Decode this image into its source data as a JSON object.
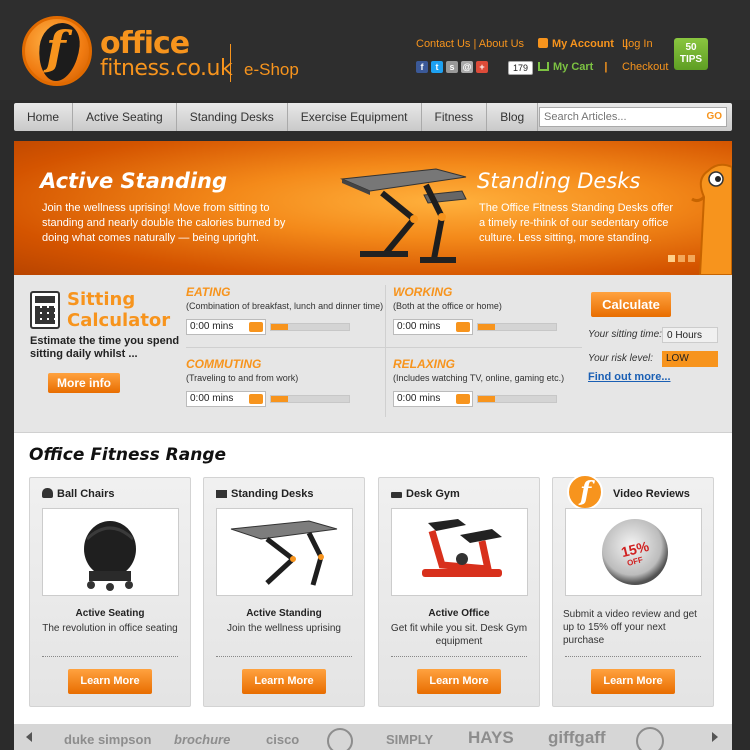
{
  "header": {
    "brand_line1": "office",
    "brand_line2": "fitness.co.uk",
    "eshop": "e-Shop",
    "contact": "Contact Us",
    "about": "About Us",
    "separator": "|",
    "my_account": "My Account",
    "log_in": "Log In",
    "cart_count": "179",
    "my_cart": "My Cart",
    "checkout": "Checkout",
    "tips_number": "50",
    "tips_label": "TIPS"
  },
  "nav": {
    "items": [
      "Home",
      "Active Seating",
      "Standing Desks",
      "Exercise Equipment",
      "Fitness",
      "Blog"
    ],
    "search_placeholder": "Search Articles...",
    "search_go": "GO"
  },
  "banner": {
    "left_title": "Active Standing",
    "left_text": "Join the wellness uprising! Move from sitting to standing and nearly double the calories burned by doing what comes naturally — being upright.",
    "right_title": "Standing Desks",
    "right_text": "The Office Fitness Standing Desks offer a timely re-think of our sedentary office culture. Less sitting, more standing."
  },
  "calculator": {
    "title_line1": "Sitting",
    "title_line2": "Calculator",
    "description": "Estimate the time you spend sitting daily whilst ...",
    "more_info": "More info",
    "activities": [
      {
        "title": "EATING",
        "desc": "(Combination of breakfast, lunch and dinner time)",
        "value": "0:00 mins",
        "level": 0.22
      },
      {
        "title": "WORKING",
        "desc": "(Both at the office or home)",
        "value": "0:00 mins",
        "level": 0.22
      },
      {
        "title": "COMMUTING",
        "desc": "(Traveling to and from work)",
        "value": "0:00 mins",
        "level": 0.22
      },
      {
        "title": "RELAXING",
        "desc": "(Includes watching TV, online, gaming etc.)",
        "value": "0:00 mins",
        "level": 0.22
      }
    ],
    "calculate": "Calculate",
    "sitting_time_label": "Your sitting time:",
    "sitting_time_value": "0 Hours",
    "risk_label": "Your risk level:",
    "risk_value": "LOW",
    "find_out_more": "Find out more...",
    "risk_color": "#f7941d"
  },
  "range": {
    "title": "Office Fitness Range",
    "cards": [
      {
        "head": "Ball Chairs",
        "icon": "ball-chair-icon",
        "title": "Active Seating",
        "desc": "The revolution in office seating",
        "button": "Learn More"
      },
      {
        "head": "Standing Desks",
        "icon": "standing-desk-icon",
        "title": "Active Standing",
        "desc": "Join the wellness uprising",
        "button": "Learn More"
      },
      {
        "head": "Desk Gym",
        "icon": "desk-gym-icon",
        "title": "Active Office",
        "desc": "Get fit while you sit. Desk Gym equipment",
        "button": "Learn More"
      },
      {
        "head": "Video Reviews",
        "icon": "video-icon",
        "title": "",
        "desc": "Submit a video review and get up to 15% off your next purchase",
        "badge": "15%",
        "badge_sub": "OFF",
        "button": "Learn More"
      }
    ]
  },
  "logos": [
    "duke simpson",
    "brochure",
    "cisco",
    "SIMPLY",
    "HAYS",
    "giffgaff"
  ],
  "colors": {
    "accent": "#f7941d",
    "cart": "#7cc242",
    "tips": "#6fae2c"
  }
}
